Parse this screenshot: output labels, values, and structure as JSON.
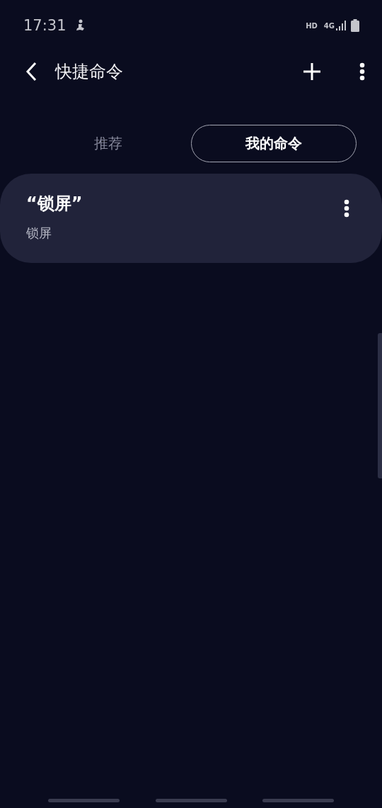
{
  "status_bar": {
    "time": "17:31",
    "hd": "HD",
    "network": "4G"
  },
  "app_bar": {
    "title": "快捷命令"
  },
  "tabs": [
    {
      "label": "推荐",
      "selected": false
    },
    {
      "label": "我的命令",
      "selected": true
    }
  ],
  "commands": [
    {
      "title": "“锁屏”",
      "action": "锁屏"
    }
  ]
}
